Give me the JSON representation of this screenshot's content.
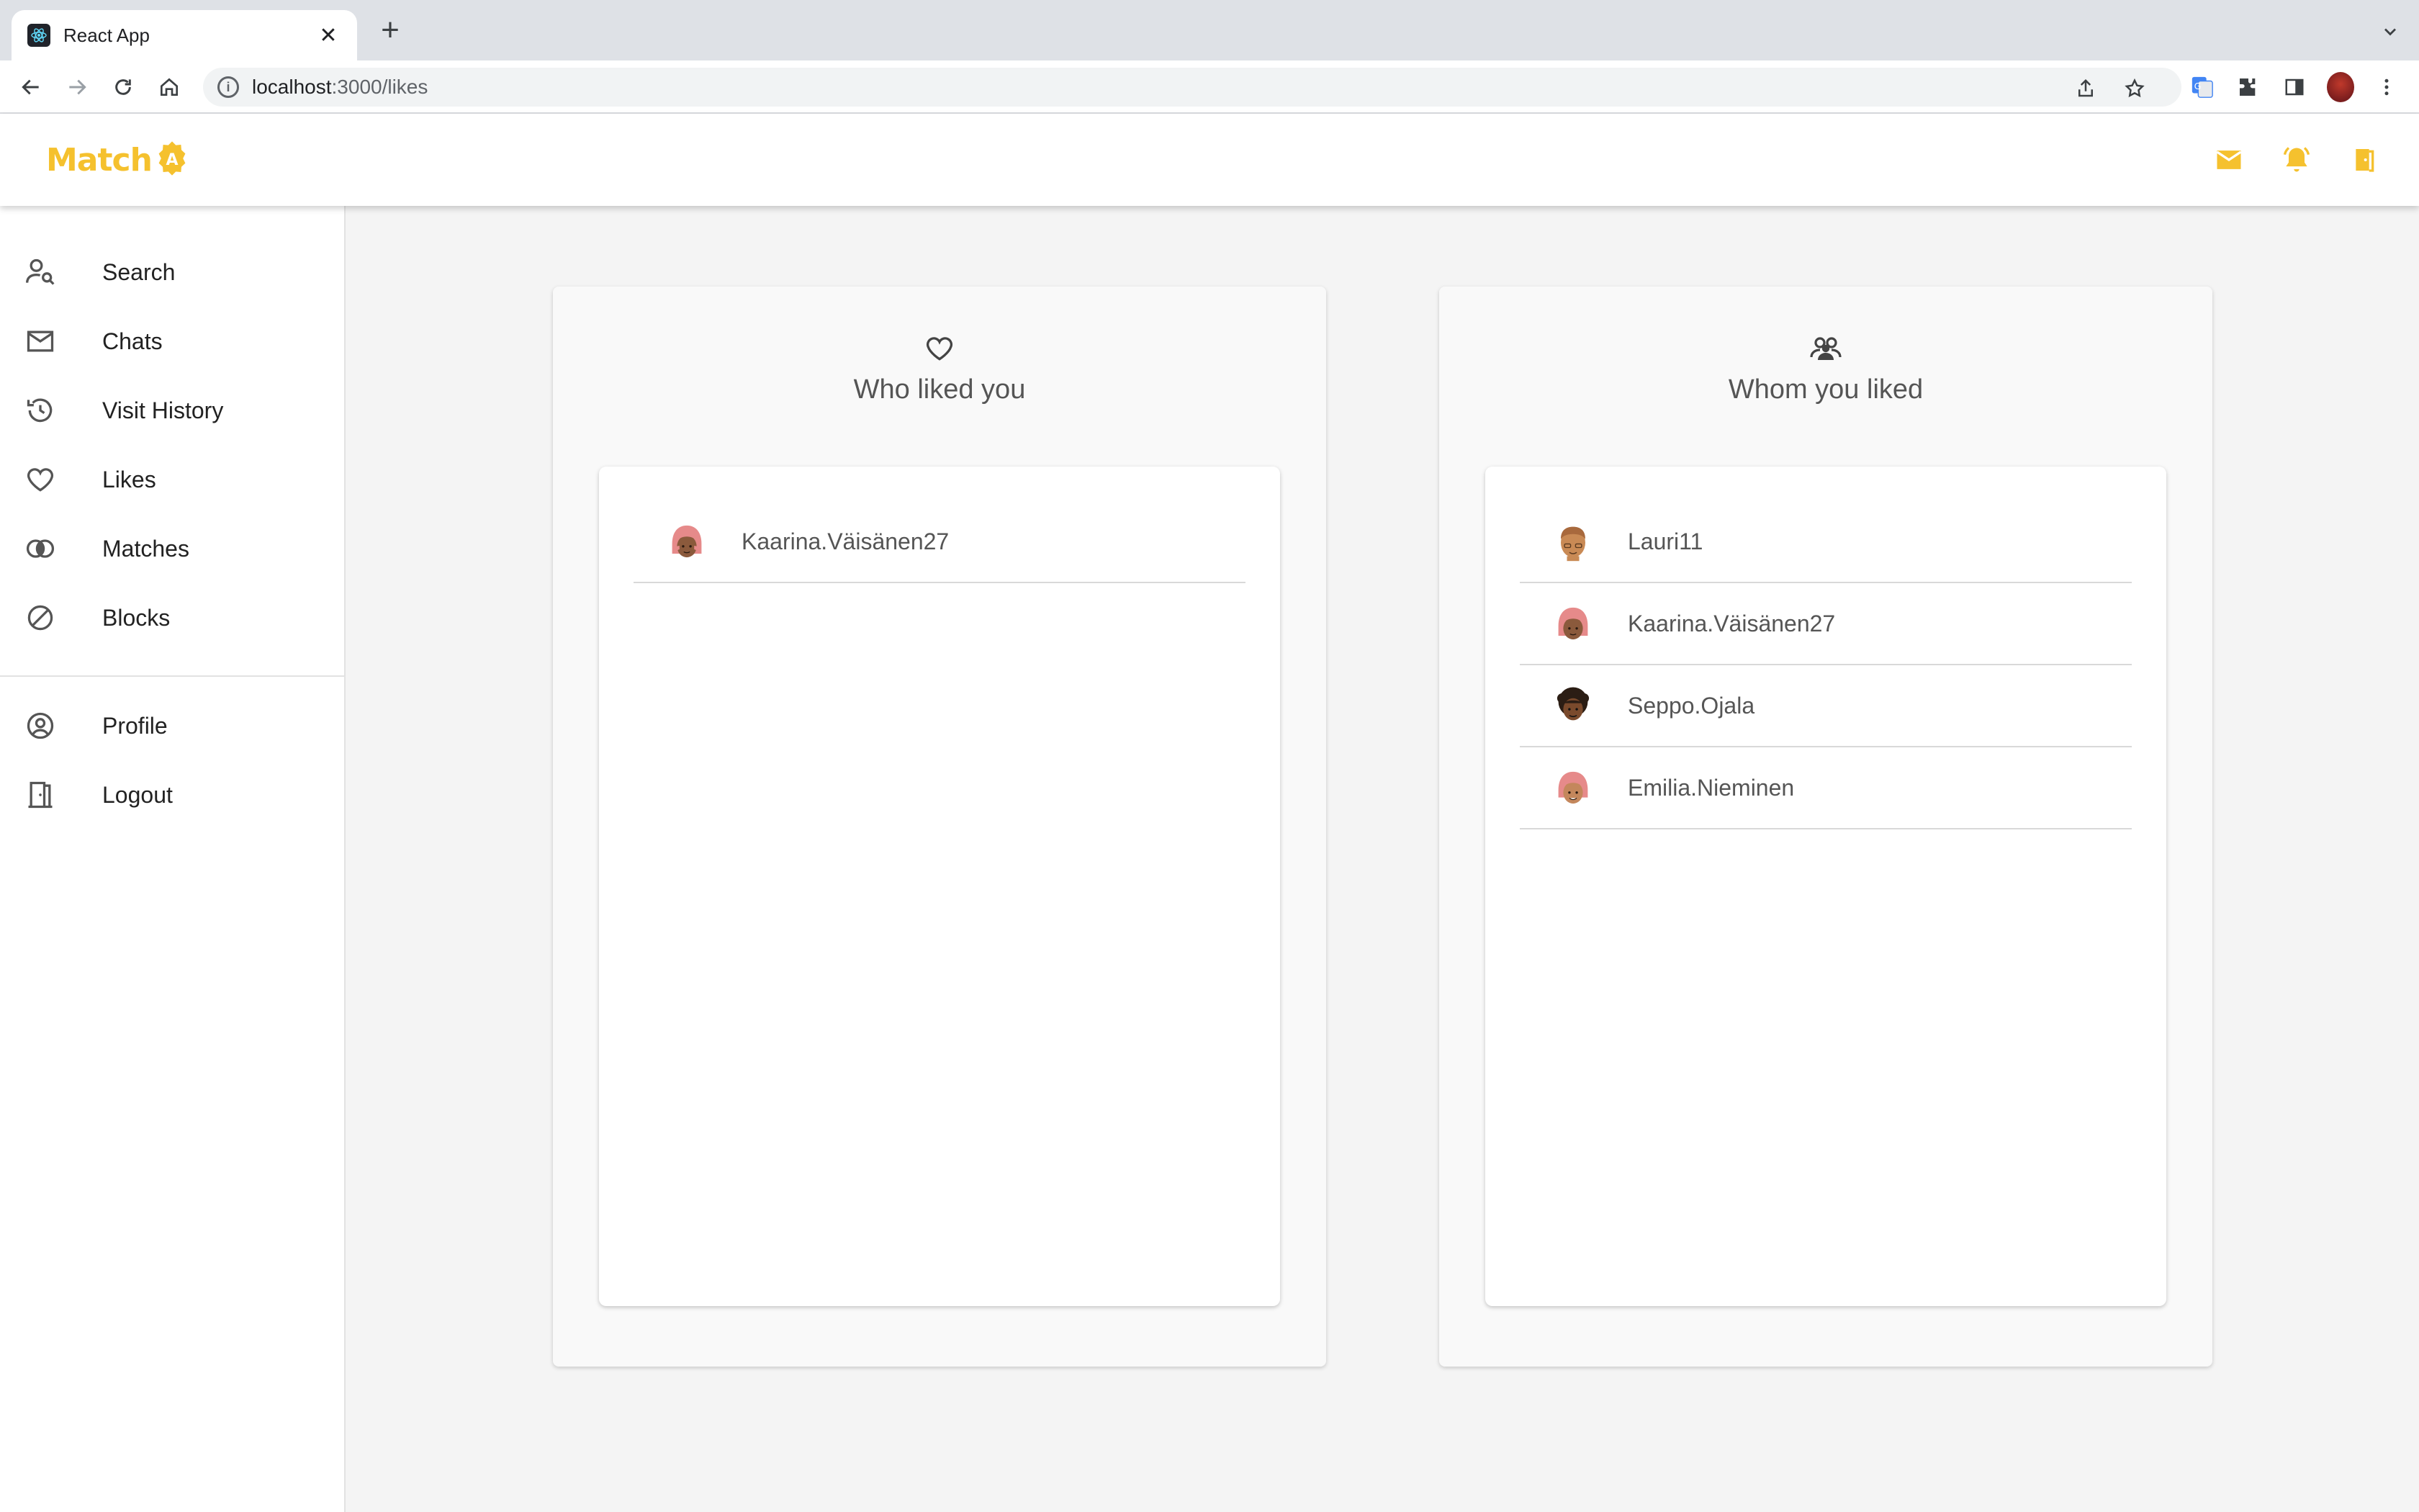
{
  "browser": {
    "tab_title": "React App",
    "url_host": "localhost",
    "url_path": ":3000/likes"
  },
  "header": {
    "logo_text": "Match",
    "logo_badge": "A"
  },
  "sidebar": {
    "items": [
      {
        "label": "Search",
        "icon": "person-search-icon"
      },
      {
        "label": "Chats",
        "icon": "mail-outline-icon"
      },
      {
        "label": "Visit History",
        "icon": "history-icon"
      },
      {
        "label": "Likes",
        "icon": "heart-outline-icon"
      },
      {
        "label": "Matches",
        "icon": "matches-rings-icon"
      },
      {
        "label": "Blocks",
        "icon": "block-icon"
      }
    ],
    "bottom_items": [
      {
        "label": "Profile",
        "icon": "account-circle-icon"
      },
      {
        "label": "Logout",
        "icon": "door-icon"
      }
    ]
  },
  "panels": {
    "left": {
      "title": "Who liked you",
      "icon": "heart-outline-icon",
      "users": [
        "Kaarina.Väisänen27"
      ]
    },
    "right": {
      "title": "Whom you liked",
      "icon": "group-icon",
      "users": [
        "Lauri11",
        "Kaarina.Väisänen27",
        "Seppo.Ojala",
        "Emilia.Nieminen"
      ]
    }
  },
  "colors": {
    "accent": "#f5c12e",
    "text": "#222222",
    "muted": "#555555"
  }
}
